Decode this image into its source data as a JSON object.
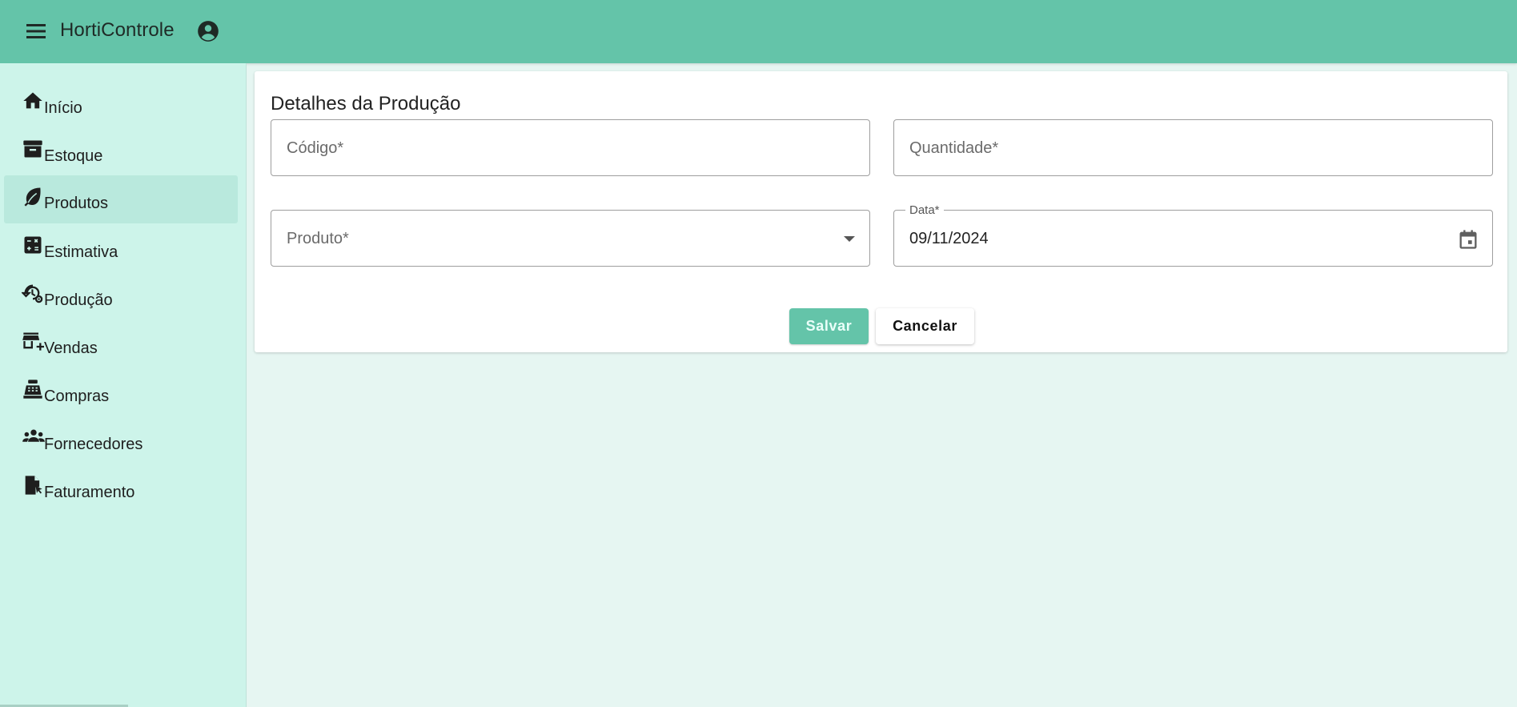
{
  "header": {
    "menu_icon": "hamburger-menu-icon",
    "title": "HortiControle",
    "account_icon": "account-circle-icon"
  },
  "sidebar": {
    "items": [
      {
        "label": "Início",
        "icon": "home-icon"
      },
      {
        "label": "Estoque",
        "icon": "archive-icon"
      },
      {
        "label": "Produtos",
        "icon": "leaf-icon",
        "active": true
      },
      {
        "label": "Estimativa",
        "icon": "calculator-icon"
      },
      {
        "label": "Produção",
        "icon": "history-gear-icon"
      },
      {
        "label": "Vendas",
        "icon": "store-plus-icon"
      },
      {
        "label": "Compras",
        "icon": "cash-register-icon"
      },
      {
        "label": "Fornecedores",
        "icon": "people-icon"
      },
      {
        "label": "Faturamento",
        "icon": "file-cursor-icon"
      }
    ]
  },
  "form": {
    "title": "Detalhes da Produção",
    "codigo": {
      "placeholder": "Código*",
      "value": ""
    },
    "quantidade": {
      "placeholder": "Quantidade*",
      "value": ""
    },
    "produto": {
      "placeholder": "Produto*",
      "value": ""
    },
    "data": {
      "label": "Data*",
      "value": "09/11/2024"
    },
    "save_label": "Salvar",
    "cancel_label": "Cancelar"
  },
  "colors": {
    "header_bg": "#64c4a9",
    "sidebar_bg": "#cdf4ea",
    "content_bg": "#e6f6f2",
    "accent": "#64c4a9"
  }
}
